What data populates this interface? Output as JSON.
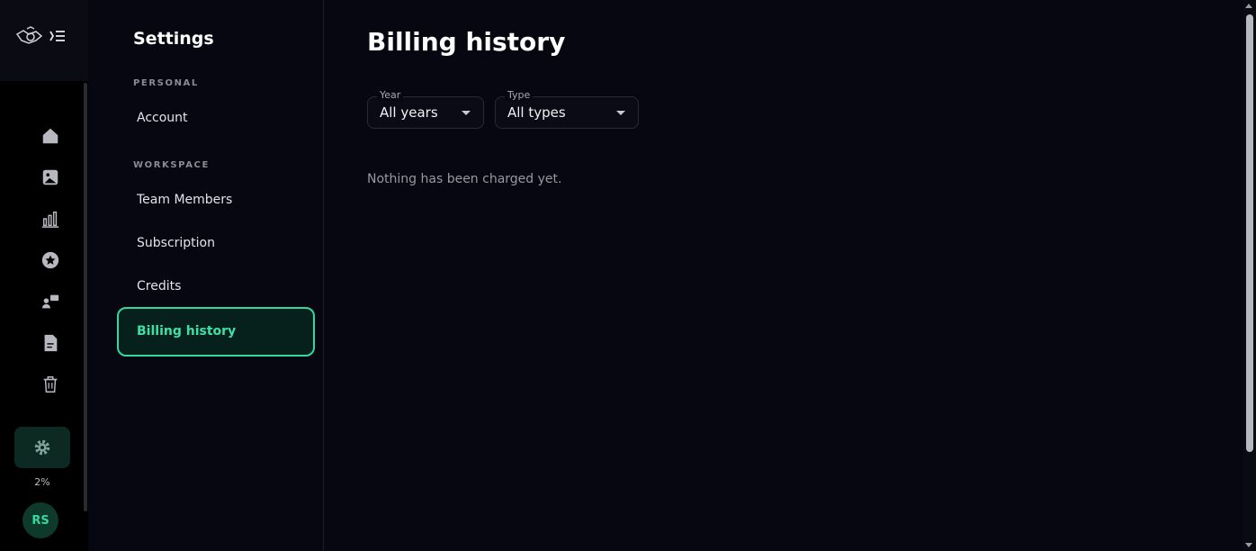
{
  "rail": {
    "usage_percent": "2%",
    "avatar_initials": "RS",
    "icons": [
      "home-icon",
      "image-icon",
      "chart-icon",
      "star-icon",
      "users-icon",
      "document-icon",
      "trash-icon",
      "gear-icon"
    ]
  },
  "nav": {
    "title": "Settings",
    "personal_label": "PERSONAL",
    "account": "Account",
    "workspace_label": "WORKSPACE",
    "team_members": "Team Members",
    "subscription": "Subscription",
    "credits": "Credits",
    "billing_history": "Billing history"
  },
  "main": {
    "title": "Billing history",
    "year_filter": {
      "label": "Year",
      "value": "All years"
    },
    "type_filter": {
      "label": "Type",
      "value": "All types"
    },
    "empty_message": "Nothing has been charged yet."
  },
  "colors": {
    "accent": "#36d6a0",
    "background": "#070711"
  }
}
